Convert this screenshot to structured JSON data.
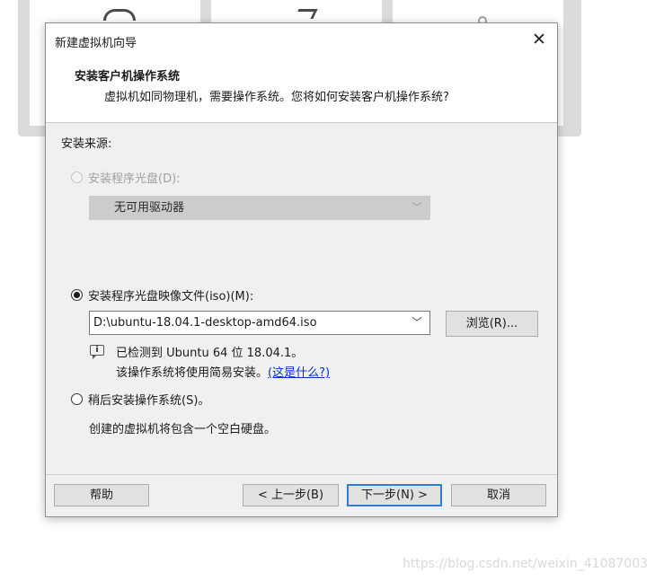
{
  "window": {
    "title": "新建虚拟机向导"
  },
  "header": {
    "title": "安装客户机操作系统",
    "subtitle": "虚拟机如同物理机，需要操作系统。您将如何安装客户机操作系统?"
  },
  "install_source": {
    "label": "安装来源:",
    "options": [
      {
        "label": "安装程序光盘(D):",
        "selected": false,
        "enabled": false
      },
      {
        "label": "安装程序光盘映像文件(iso)(M):",
        "selected": true,
        "enabled": true
      },
      {
        "label": "稍后安装操作系统(S)。",
        "selected": false,
        "enabled": true
      }
    ],
    "drive_select": {
      "value": "无可用驱动器",
      "enabled": false
    },
    "iso_path": {
      "value": "D:\\ubuntu-18.04.1-desktop-amd64.iso"
    },
    "browse_label": "浏览(R)...",
    "detected_line": "已检测到 Ubuntu 64 位 18.04.1。",
    "easy_install_text": "该操作系统将使用简易安装。",
    "what_is_this_link": "(这是什么?)",
    "later_description": "创建的虚拟机将包含一个空白硬盘。"
  },
  "footer": {
    "help": "帮助",
    "back": "< 上一步(B)",
    "next": "下一步(N) >",
    "cancel": "取消"
  },
  "icons": {
    "close": "close-icon",
    "dropdown": "chevron-down-icon",
    "info": "info-icon"
  },
  "colors": {
    "accent": "#2b7fd6",
    "link": "#0033cc"
  },
  "watermark": "https://blog.csdn.net/weixin_41087003"
}
